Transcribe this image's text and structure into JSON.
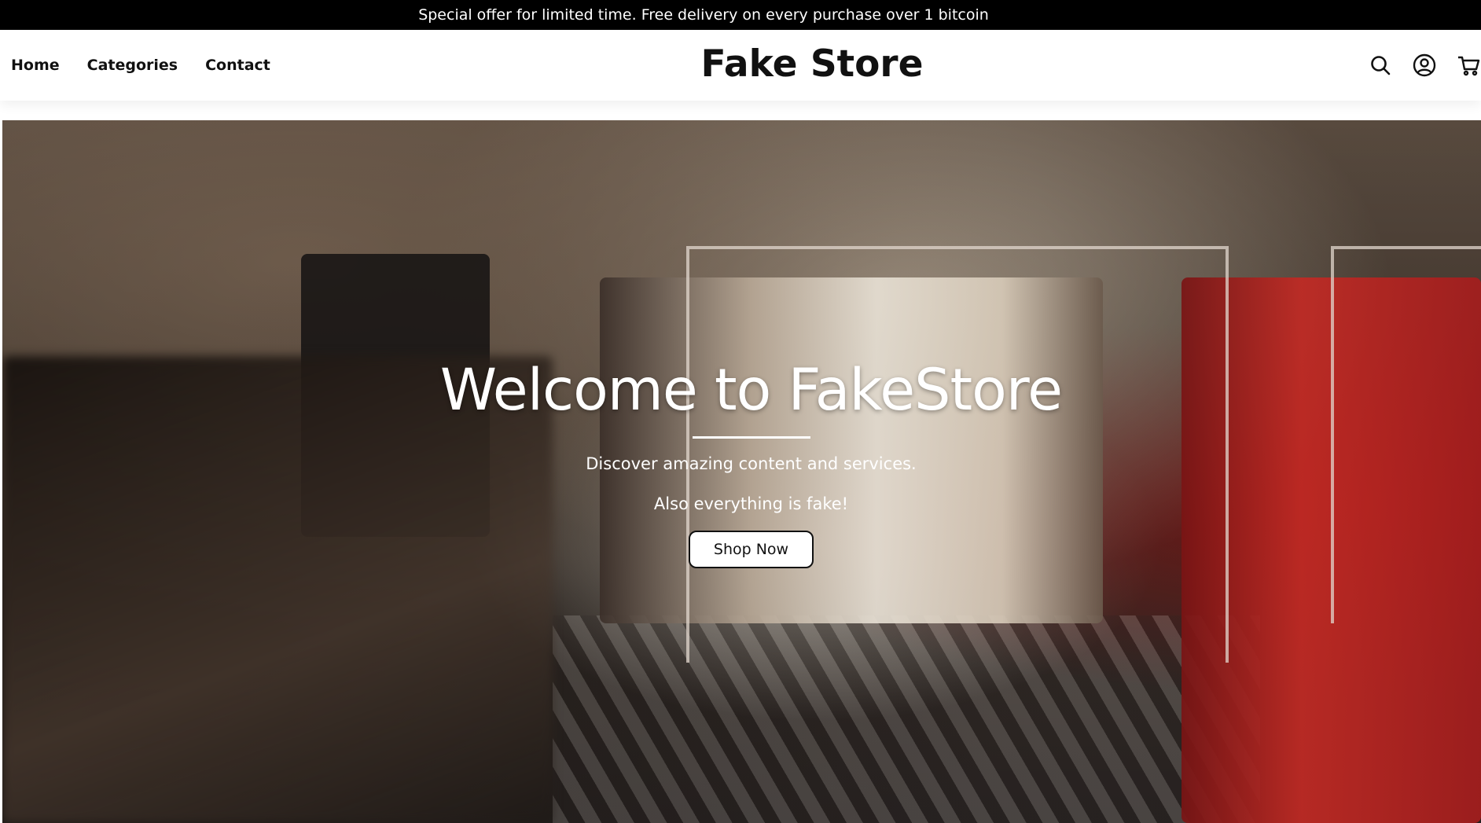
{
  "promo": {
    "text": "Special offer for limited time. Free delivery on every purchase over 1 bitcoin"
  },
  "header": {
    "nav": {
      "home": "Home",
      "categories": "Categories",
      "contact": "Contact"
    },
    "brand": "Fake Store",
    "icons": [
      "search-icon",
      "user-account-icon",
      "cart-icon"
    ]
  },
  "hero": {
    "title": "Welcome to FakeStore",
    "subtitle": "Discover amazing content and services.",
    "tagline": "Also everything is fake!",
    "cta_label": "Shop Now"
  },
  "colors": {
    "promo_bg": "#000000",
    "header_bg": "#ffffff",
    "text_dark": "#111111",
    "hero_text": "#ffffff"
  }
}
